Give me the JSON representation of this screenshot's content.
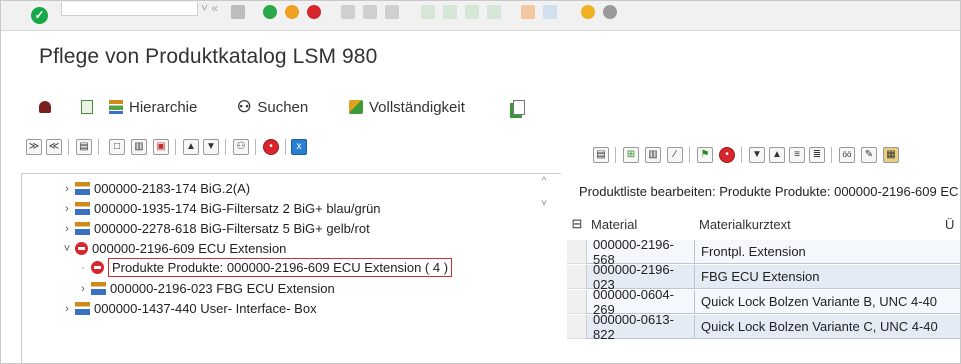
{
  "window": {
    "title": "Pflege von Produktkatalog LSM 980"
  },
  "app_toolbar": {
    "hierarchy_label": "Hierarchie",
    "search_label": "Suchen",
    "completeness_label": "Vollständigkeit"
  },
  "tree": {
    "rows": [
      {
        "label": "000000-2183-174 BiG.2(A)",
        "arrow": "›"
      },
      {
        "label": "000000-1935-174 BiG-Filtersatz 2 BiG+ blau/grün",
        "arrow": "›"
      },
      {
        "label": "000000-2278-618 BiG-Filtersatz 5  BiG+ gelb/rot",
        "arrow": "›"
      },
      {
        "label": "000000-2196-609 ECU Extension",
        "arrow": "˅"
      },
      {
        "label": "Produkte Produkte: 000000-2196-609 ECU Extension ( 4 )",
        "arrow": "·"
      },
      {
        "label": "000000-2196-023 FBG ECU Extension",
        "arrow": "›"
      },
      {
        "label": "000000-1437-440 User- Interface- Box",
        "arrow": "›"
      }
    ]
  },
  "list": {
    "header": "Produktliste bearbeiten: Produkte Produkte: 000000-2196-609 EC",
    "columns": [
      "Material",
      "Materialkurztext",
      "Ü"
    ],
    "rows": [
      {
        "material": "000000-2196-568",
        "text": "Frontpl. Extension"
      },
      {
        "material": "000000-2196-023",
        "text": "FBG ECU Extension"
      },
      {
        "material": "000000-0604-269",
        "text": "Quick Lock Bolzen Variante B, UNC 4-40"
      },
      {
        "material": "000000-0613-822",
        "text": "Quick Lock Bolzen Variante C, UNC 4-40"
      }
    ]
  },
  "colors": {
    "ok_green": "#17a84a",
    "stop_red": "#d8262e",
    "row_blue": "#e4ebf5"
  }
}
